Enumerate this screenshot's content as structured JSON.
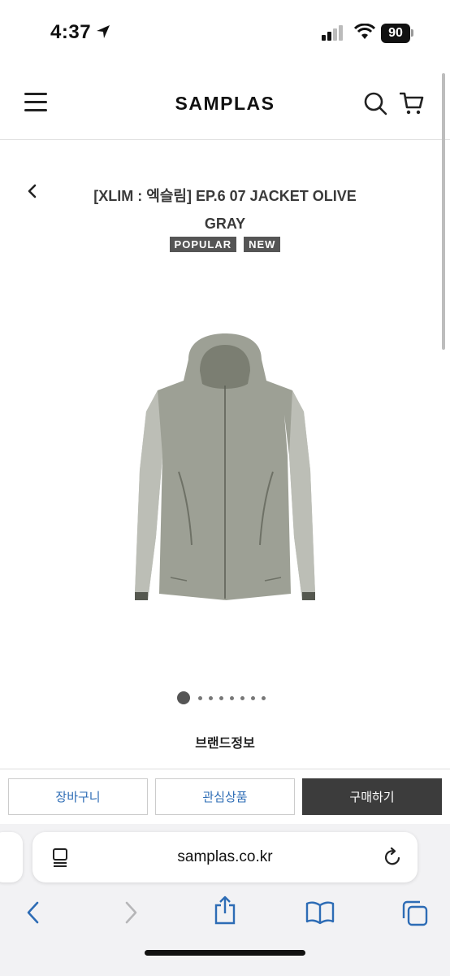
{
  "status": {
    "time": "4:37",
    "battery": "90"
  },
  "header": {
    "logo": "SAMPLAS"
  },
  "product": {
    "title": "[XLIM : 엑슬림] EP.6 07 JACKET OLIVE GRAY",
    "badges": [
      "POPULAR",
      "NEW"
    ],
    "image_count": 8,
    "active_image": 1
  },
  "brand_info_label": "브랜드정보",
  "actions": {
    "cart": "장바구니",
    "wishlist": "관심상품",
    "buy": "구매하기"
  },
  "browser": {
    "url": "samplas.co.kr"
  },
  "colors": {
    "accent": "#2d6cb5",
    "buy_button": "#3c3c3c",
    "badge": "#555555",
    "jacket": "#8c8f82"
  }
}
